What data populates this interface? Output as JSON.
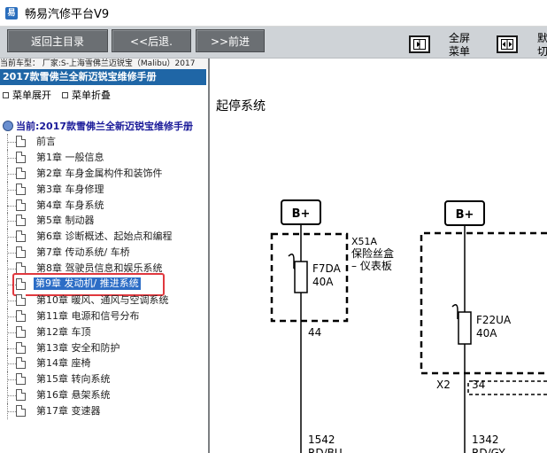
{
  "window": {
    "title": "畅易汽修平台V9",
    "icon": "app-logo-icon"
  },
  "toolbar": {
    "back_main": "返回主目录",
    "back": "<<后退.",
    "forward": ">>前进",
    "fullscreen_line1": "全屏",
    "fullscreen_line2": "菜单",
    "right_line1": "默",
    "right_line2": "切"
  },
  "car_type": "当前车型： 厂家:S-上海雪佛兰迈锐宝（Malibu）2017",
  "left": {
    "manual_title": "2017款雪佛兰全新迈锐宝维修手册",
    "expand": "菜单展开",
    "collapse": "菜单折叠",
    "current": "当前:2017款雪佛兰全新迈锐宝维修手册",
    "items": [
      {
        "label": "前言"
      },
      {
        "label": "第1章 一般信息"
      },
      {
        "label": "第2章 车身金属构件和装饰件"
      },
      {
        "label": "第3章 车身修理"
      },
      {
        "label": "第4章 车身系统"
      },
      {
        "label": "第5章 制动器"
      },
      {
        "label": "第6章 诊断概述、起始点和编程"
      },
      {
        "label": "第7章 传动系统/ 车桥"
      },
      {
        "label": "第8章 驾驶员信息和娱乐系统"
      },
      {
        "label": "第9章 发动机/ 推进系统"
      },
      {
        "label": "第10章 暖风、通风与空调系统"
      },
      {
        "label": "第11章 电源和信号分布"
      },
      {
        "label": "第12章 车顶"
      },
      {
        "label": "第13章 安全和防护"
      },
      {
        "label": "第14章 座椅"
      },
      {
        "label": "第15章 转向系统"
      },
      {
        "label": "第16章 悬架系统"
      },
      {
        "label": "第17章 变速器"
      }
    ],
    "selected_index": 9
  },
  "content": {
    "title": "起停系统",
    "diagram": {
      "bplus_left": "B+",
      "bplus_right": "B+",
      "fuse_box_code": "X51A",
      "fuse_box_line1": "保险丝盒",
      "fuse_box_line2": "– 仪表板",
      "fuse1_name": "F7DA",
      "fuse1_rating": "40A",
      "fuse1_pin": "44",
      "fuse2_name": "F22UA",
      "fuse2_rating": "40A",
      "connector": "X2",
      "fuse2_pin": "34",
      "wire1_num": "1542",
      "wire1_color": "RD/BU",
      "wire2_num": "1342",
      "wire2_color": "RD/GY"
    }
  },
  "colors": {
    "toolbar_bg": "#cfd3d7",
    "button_bg": "#6b6f73",
    "manual_title_bg": "#1f66a6",
    "selection_bg": "#2c6dc6",
    "highlight_box": "#e0383e"
  }
}
